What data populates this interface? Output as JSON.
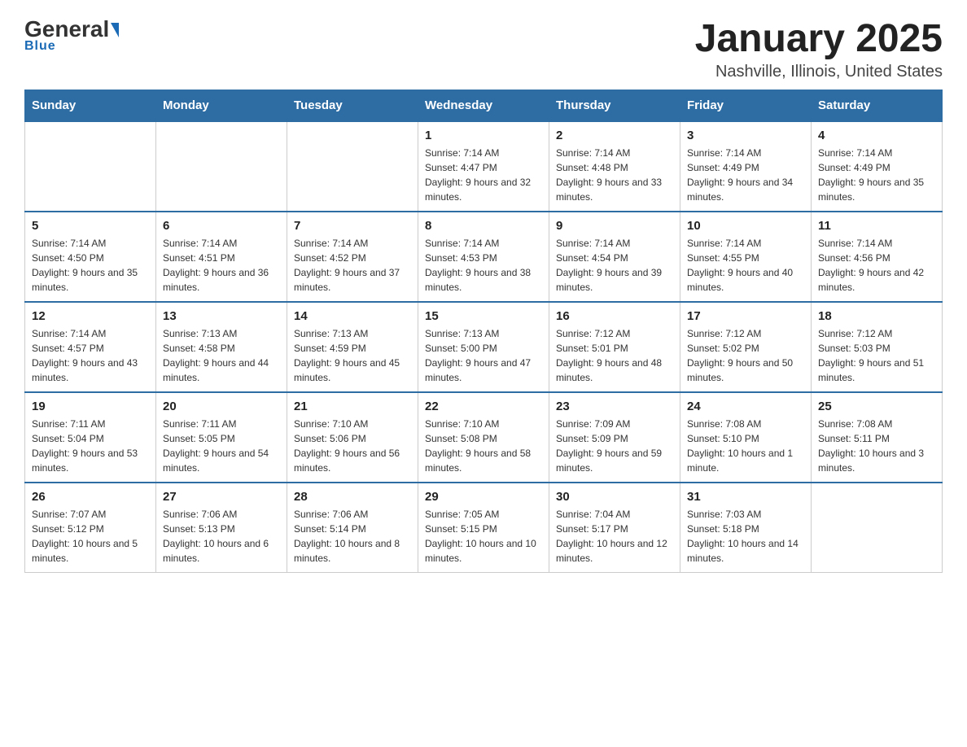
{
  "header": {
    "logo_general": "General",
    "logo_blue": "Blue",
    "logo_subtitle": "Blue",
    "month_title": "January 2025",
    "location": "Nashville, Illinois, United States"
  },
  "days_of_week": [
    "Sunday",
    "Monday",
    "Tuesday",
    "Wednesday",
    "Thursday",
    "Friday",
    "Saturday"
  ],
  "weeks": [
    [
      {
        "day": "",
        "info": ""
      },
      {
        "day": "",
        "info": ""
      },
      {
        "day": "",
        "info": ""
      },
      {
        "day": "1",
        "info": "Sunrise: 7:14 AM\nSunset: 4:47 PM\nDaylight: 9 hours and 32 minutes."
      },
      {
        "day": "2",
        "info": "Sunrise: 7:14 AM\nSunset: 4:48 PM\nDaylight: 9 hours and 33 minutes."
      },
      {
        "day": "3",
        "info": "Sunrise: 7:14 AM\nSunset: 4:49 PM\nDaylight: 9 hours and 34 minutes."
      },
      {
        "day": "4",
        "info": "Sunrise: 7:14 AM\nSunset: 4:49 PM\nDaylight: 9 hours and 35 minutes."
      }
    ],
    [
      {
        "day": "5",
        "info": "Sunrise: 7:14 AM\nSunset: 4:50 PM\nDaylight: 9 hours and 35 minutes."
      },
      {
        "day": "6",
        "info": "Sunrise: 7:14 AM\nSunset: 4:51 PM\nDaylight: 9 hours and 36 minutes."
      },
      {
        "day": "7",
        "info": "Sunrise: 7:14 AM\nSunset: 4:52 PM\nDaylight: 9 hours and 37 minutes."
      },
      {
        "day": "8",
        "info": "Sunrise: 7:14 AM\nSunset: 4:53 PM\nDaylight: 9 hours and 38 minutes."
      },
      {
        "day": "9",
        "info": "Sunrise: 7:14 AM\nSunset: 4:54 PM\nDaylight: 9 hours and 39 minutes."
      },
      {
        "day": "10",
        "info": "Sunrise: 7:14 AM\nSunset: 4:55 PM\nDaylight: 9 hours and 40 minutes."
      },
      {
        "day": "11",
        "info": "Sunrise: 7:14 AM\nSunset: 4:56 PM\nDaylight: 9 hours and 42 minutes."
      }
    ],
    [
      {
        "day": "12",
        "info": "Sunrise: 7:14 AM\nSunset: 4:57 PM\nDaylight: 9 hours and 43 minutes."
      },
      {
        "day": "13",
        "info": "Sunrise: 7:13 AM\nSunset: 4:58 PM\nDaylight: 9 hours and 44 minutes."
      },
      {
        "day": "14",
        "info": "Sunrise: 7:13 AM\nSunset: 4:59 PM\nDaylight: 9 hours and 45 minutes."
      },
      {
        "day": "15",
        "info": "Sunrise: 7:13 AM\nSunset: 5:00 PM\nDaylight: 9 hours and 47 minutes."
      },
      {
        "day": "16",
        "info": "Sunrise: 7:12 AM\nSunset: 5:01 PM\nDaylight: 9 hours and 48 minutes."
      },
      {
        "day": "17",
        "info": "Sunrise: 7:12 AM\nSunset: 5:02 PM\nDaylight: 9 hours and 50 minutes."
      },
      {
        "day": "18",
        "info": "Sunrise: 7:12 AM\nSunset: 5:03 PM\nDaylight: 9 hours and 51 minutes."
      }
    ],
    [
      {
        "day": "19",
        "info": "Sunrise: 7:11 AM\nSunset: 5:04 PM\nDaylight: 9 hours and 53 minutes."
      },
      {
        "day": "20",
        "info": "Sunrise: 7:11 AM\nSunset: 5:05 PM\nDaylight: 9 hours and 54 minutes."
      },
      {
        "day": "21",
        "info": "Sunrise: 7:10 AM\nSunset: 5:06 PM\nDaylight: 9 hours and 56 minutes."
      },
      {
        "day": "22",
        "info": "Sunrise: 7:10 AM\nSunset: 5:08 PM\nDaylight: 9 hours and 58 minutes."
      },
      {
        "day": "23",
        "info": "Sunrise: 7:09 AM\nSunset: 5:09 PM\nDaylight: 9 hours and 59 minutes."
      },
      {
        "day": "24",
        "info": "Sunrise: 7:08 AM\nSunset: 5:10 PM\nDaylight: 10 hours and 1 minute."
      },
      {
        "day": "25",
        "info": "Sunrise: 7:08 AM\nSunset: 5:11 PM\nDaylight: 10 hours and 3 minutes."
      }
    ],
    [
      {
        "day": "26",
        "info": "Sunrise: 7:07 AM\nSunset: 5:12 PM\nDaylight: 10 hours and 5 minutes."
      },
      {
        "day": "27",
        "info": "Sunrise: 7:06 AM\nSunset: 5:13 PM\nDaylight: 10 hours and 6 minutes."
      },
      {
        "day": "28",
        "info": "Sunrise: 7:06 AM\nSunset: 5:14 PM\nDaylight: 10 hours and 8 minutes."
      },
      {
        "day": "29",
        "info": "Sunrise: 7:05 AM\nSunset: 5:15 PM\nDaylight: 10 hours and 10 minutes."
      },
      {
        "day": "30",
        "info": "Sunrise: 7:04 AM\nSunset: 5:17 PM\nDaylight: 10 hours and 12 minutes."
      },
      {
        "day": "31",
        "info": "Sunrise: 7:03 AM\nSunset: 5:18 PM\nDaylight: 10 hours and 14 minutes."
      },
      {
        "day": "",
        "info": ""
      }
    ]
  ]
}
